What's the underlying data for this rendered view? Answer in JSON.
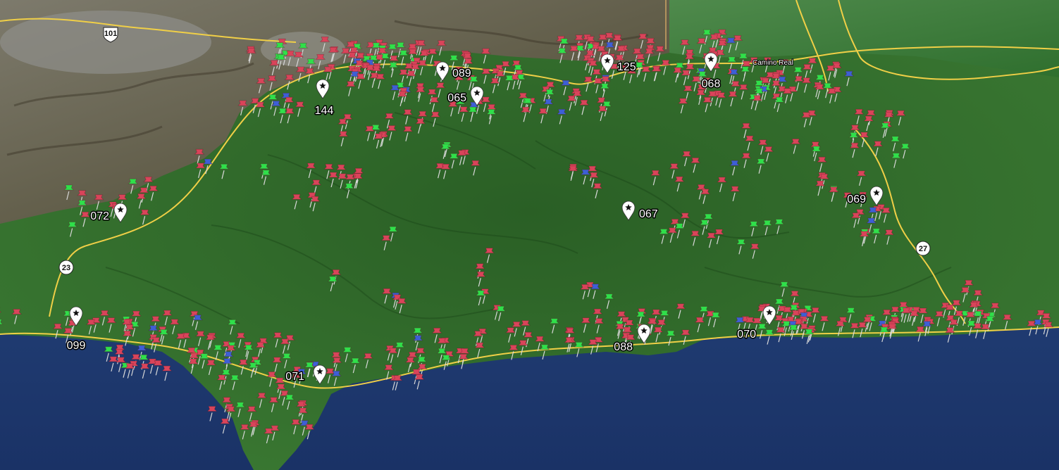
{
  "map": {
    "view": "satellite",
    "colors": {
      "ocean": "#1f3f78",
      "forest": "#2f6a2a",
      "terrain": "#6b6350",
      "urban": "#8a8a86",
      "highway": "#f0cf47",
      "pin_red": "#d9445a",
      "pin_green": "#2fe04a",
      "pin_blue": "#3d5fd6",
      "marker": "#ffffff"
    },
    "icons": {
      "pin": "pushpin-icon",
      "marker": "star-marker-icon",
      "shield": "highway-shield-icon"
    },
    "road_shields": [
      {
        "id": "101",
        "label": "101"
      },
      {
        "id": "23",
        "label": "23"
      },
      {
        "id": "27",
        "label": "27"
      }
    ],
    "road_label": "Camino Real",
    "markers": [
      {
        "id": "144",
        "label": "144"
      },
      {
        "id": "089",
        "label": "089"
      },
      {
        "id": "065",
        "label": "065"
      },
      {
        "id": "125",
        "label": "125"
      },
      {
        "id": "068",
        "label": "068"
      },
      {
        "id": "072",
        "label": "072"
      },
      {
        "id": "067",
        "label": "067"
      },
      {
        "id": "069",
        "label": "069"
      },
      {
        "id": "099",
        "label": "099"
      },
      {
        "id": "071",
        "label": "071"
      },
      {
        "id": "088",
        "label": "088"
      },
      {
        "id": "070",
        "label": "070"
      }
    ]
  }
}
